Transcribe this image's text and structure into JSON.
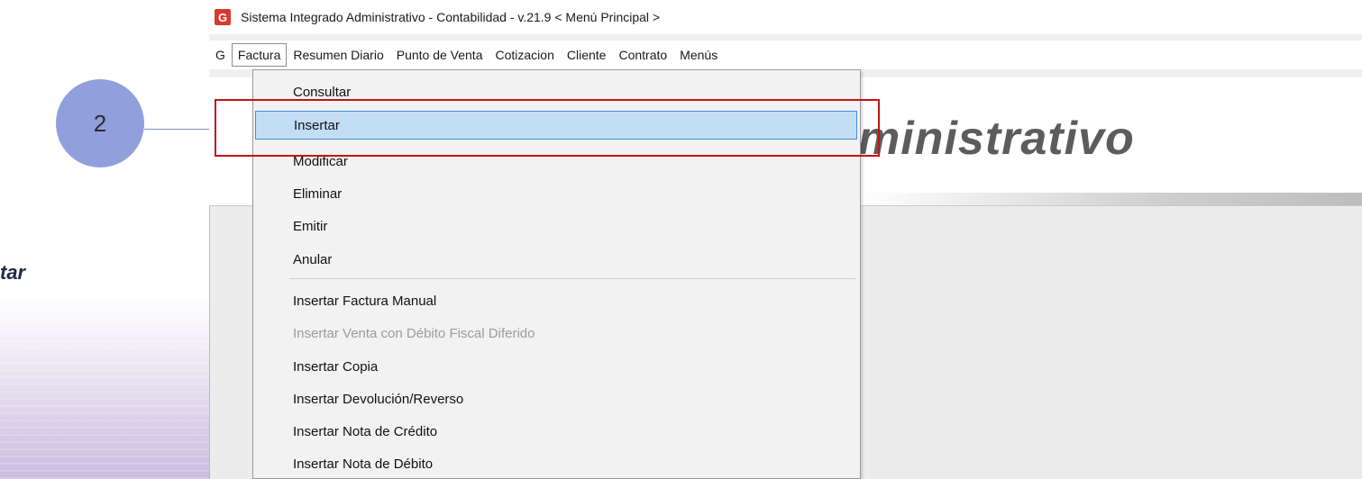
{
  "slide": {
    "step_number": "2",
    "side_caption": "tar"
  },
  "window": {
    "title": "Sistema Integrado Administrativo - Contabilidad - v.21.9 < Menú Principal >",
    "app_icon_letter": "G"
  },
  "menubar": {
    "items": [
      {
        "label": "G"
      },
      {
        "label": "Factura"
      },
      {
        "label": "Resumen Diario"
      },
      {
        "label": "Punto de Venta"
      },
      {
        "label": "Cotizacion"
      },
      {
        "label": "Cliente"
      },
      {
        "label": "Contrato"
      },
      {
        "label": "Menús"
      }
    ]
  },
  "banner": {
    "text": "ministrativo"
  },
  "dropdown": {
    "items": [
      {
        "label": "Consultar",
        "state": "normal"
      },
      {
        "label": "Insertar",
        "state": "selected"
      },
      {
        "label": "Modificar",
        "state": "normal"
      },
      {
        "label": "Eliminar",
        "state": "normal"
      },
      {
        "label": "Emitir",
        "state": "normal"
      },
      {
        "label": "Anular",
        "state": "normal"
      },
      {
        "label": "Insertar Factura Manual",
        "state": "normal"
      },
      {
        "label": "Insertar Venta con Débito Fiscal Diferido",
        "state": "disabled"
      },
      {
        "label": "Insertar Copia",
        "state": "normal"
      },
      {
        "label": "Insertar Devolución/Reverso",
        "state": "normal"
      },
      {
        "label": "Insertar Nota de Crédito",
        "state": "normal"
      },
      {
        "label": "Insertar Nota de Débito",
        "state": "normal"
      }
    ]
  },
  "colors": {
    "highlight_box": "#c0141a",
    "selected_bg": "#c3ddf5",
    "step_circle": "#8fa0dc"
  }
}
